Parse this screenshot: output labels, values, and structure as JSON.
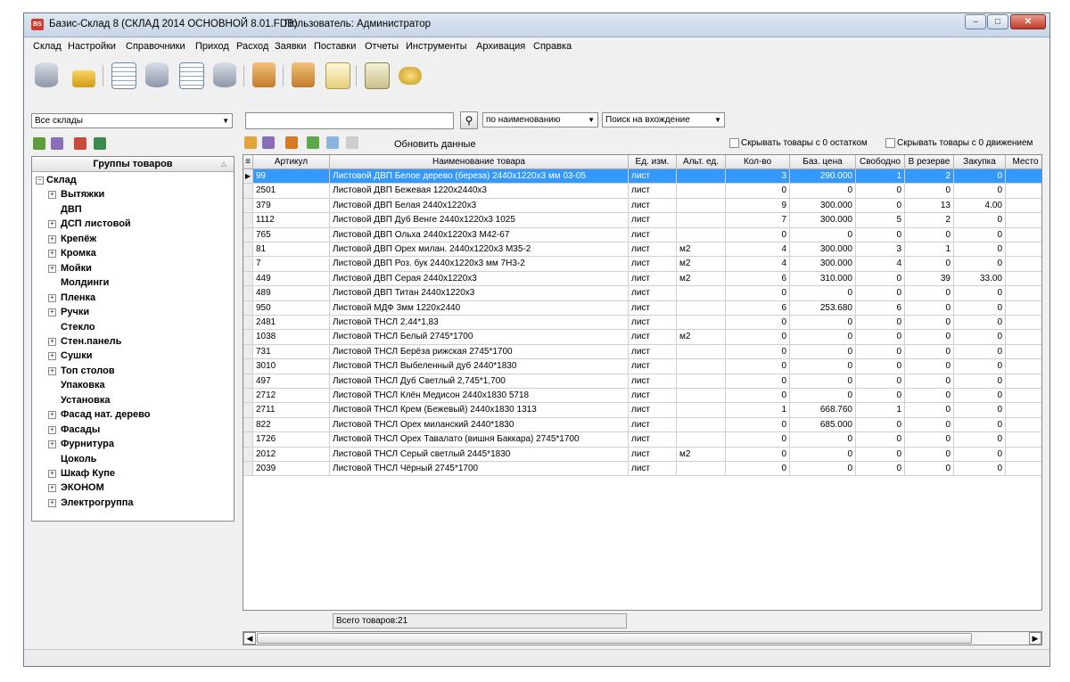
{
  "window": {
    "title": "Базис-Склад 8 (СКЛАД 2014 ОСНОВНОЙ 8.01.FDB)",
    "user": "Пользователь: Администратор",
    "app_icon_text": "BS",
    "buttons": [
      "–",
      "□",
      "✕"
    ]
  },
  "menu": [
    "Склад",
    "Настройки",
    "Справочники",
    "Приход",
    "Расход",
    "Заявки",
    "Поставки",
    "Отчеты",
    "Инструменты",
    "Архивация",
    "Справка"
  ],
  "toolbar_icons": [
    "database-icon",
    "lock-icon",
    "table-icon",
    "database-settings-icon",
    "table-settings-icon",
    "database-save-icon",
    "box-in-icon",
    "box-out-icon",
    "documents-icon",
    "export-icon",
    "coins-icon"
  ],
  "filters": {
    "warehouse": "Все склады",
    "search_value": "",
    "search_mode": "по наименованию",
    "search_type": "Поиск на вхождение"
  },
  "grid_toolbar": {
    "refresh_label": "Обновить данные",
    "hide_zero_stock": "Скрывать товары с 0 остатком",
    "hide_zero_movement": "Скрывать товары с 0 движением"
  },
  "groups": {
    "header": "Группы товаров",
    "root": "Склад",
    "items": [
      {
        "label": "Вытяжки",
        "expandable": true
      },
      {
        "label": "ДВП",
        "expandable": false
      },
      {
        "label": "ДСП листовой",
        "expandable": true
      },
      {
        "label": "Крепёж",
        "expandable": true
      },
      {
        "label": "Кромка",
        "expandable": true
      },
      {
        "label": "Мойки",
        "expandable": true
      },
      {
        "label": "Молдинги",
        "expandable": false
      },
      {
        "label": "Пленка",
        "expandable": true
      },
      {
        "label": "Ручки",
        "expandable": true
      },
      {
        "label": "Стекло",
        "expandable": false
      },
      {
        "label": "Стен.панель",
        "expandable": true
      },
      {
        "label": "Сушки",
        "expandable": true
      },
      {
        "label": "Топ столов",
        "expandable": true
      },
      {
        "label": "Упаковка",
        "expandable": false
      },
      {
        "label": "Установка",
        "expandable": false
      },
      {
        "label": "Фасад нат. дерево",
        "expandable": true
      },
      {
        "label": "Фасады",
        "expandable": true
      },
      {
        "label": "Фурнитура",
        "expandable": true
      },
      {
        "label": "Цоколь",
        "expandable": false
      },
      {
        "label": "Шкаф Купе",
        "expandable": true
      },
      {
        "label": "ЭКОНОМ",
        "expandable": true
      },
      {
        "label": "Электрогруппа",
        "expandable": true
      }
    ]
  },
  "table": {
    "columns": [
      "Артикул",
      "Наименование товара",
      "Ед. изм.",
      "Альт. ед.",
      "Кол-во",
      "Баз. цена",
      "Свободно",
      "В резерве",
      "Закупка",
      "Место"
    ],
    "rows": [
      [
        "99",
        "Листовой ДВП Белое дерево (береза)  2440х1220х3 мм  03-05",
        "лист",
        "",
        "3",
        "290.000",
        "1",
        "2",
        "0"
      ],
      [
        "2501",
        "Листовой ДВП Бежевая  1220х2440х3",
        "лист",
        "",
        "0",
        "0",
        "0",
        "0",
        "0"
      ],
      [
        "379",
        "Листовой ДВП Белая 2440х1220х3",
        "лист",
        "",
        "9",
        "300.000",
        "0",
        "13",
        "4.00"
      ],
      [
        "1112",
        "Листовой ДВП Дуб Венге  2440х1220х3  1025",
        "лист",
        "",
        "7",
        "300.000",
        "5",
        "2",
        "0"
      ],
      [
        "765",
        "Листовой ДВП Ольха  2440х1220х3  М42-67",
        "лист",
        "",
        "0",
        "0",
        "0",
        "0",
        "0"
      ],
      [
        "81",
        "Листовой ДВП Орех милан.  2440х1220х3  М35-2",
        "лист",
        "м2",
        "4",
        "300.000",
        "3",
        "1",
        "0"
      ],
      [
        "7",
        "Листовой ДВП Роз. бук  2440х1220х3 мм  7Н3-2",
        "лист",
        "м2",
        "4",
        "300.000",
        "4",
        "0",
        "0"
      ],
      [
        "449",
        "Листовой ДВП Серая  2440х1220х3",
        "лист",
        "м2",
        "6",
        "310.000",
        "0",
        "39",
        "33.00"
      ],
      [
        "489",
        "Листовой ДВП Титан 2440х1220х3",
        "лист",
        "",
        "0",
        "0",
        "0",
        "0",
        "0"
      ],
      [
        "950",
        "Листовой МДФ 3мм 1220х2440",
        "лист",
        "",
        "6",
        "253.680",
        "6",
        "0",
        "0"
      ],
      [
        "2481",
        "Листовой ТНСЛ  2,44*1,83",
        "лист",
        "",
        "0",
        "0",
        "0",
        "0",
        "0"
      ],
      [
        "1038",
        "Листовой ТНСЛ Белый  2745*1700",
        "лист",
        "м2",
        "0",
        "0",
        "0",
        "0",
        "0"
      ],
      [
        "731",
        "Листовой ТНСЛ Берёза рижская  2745*1700",
        "лист",
        "",
        "0",
        "0",
        "0",
        "0",
        "0"
      ],
      [
        "3010",
        "Листовой ТНСЛ Выбеленный дуб  2440*1830",
        "лист",
        "",
        "0",
        "0",
        "0",
        "0",
        "0"
      ],
      [
        "497",
        "Листовой ТНСЛ Дуб Светлый  2,745*1,700",
        "лист",
        "",
        "0",
        "0",
        "0",
        "0",
        "0"
      ],
      [
        "2712",
        "Листовой ТНСЛ Клён Медисон  2440х1830  5718",
        "лист",
        "",
        "0",
        "0",
        "0",
        "0",
        "0"
      ],
      [
        "2711",
        "Листовой ТНСЛ Крем (Бежевый)  2440х1830  1313",
        "лист",
        "",
        "1",
        "668.760",
        "1",
        "0",
        "0"
      ],
      [
        "822",
        "Листовой ТНСЛ Орех  миланский  2440*1830",
        "лист",
        "",
        "0",
        "685.000",
        "0",
        "0",
        "0"
      ],
      [
        "1726",
        "Листовой ТНСЛ Орех Тавалато (вишня Баккара) 2745*1700",
        "лист",
        "",
        "0",
        "0",
        "0",
        "0",
        "0"
      ],
      [
        "2012",
        "Листовой ТНСЛ Серый светлый  2445*1830",
        "лист",
        "м2",
        "0",
        "0",
        "0",
        "0",
        "0"
      ],
      [
        "2039",
        "Листовой ТНСЛ Чёрный  2745*1700",
        "лист",
        "",
        "0",
        "0",
        "0",
        "0",
        "0"
      ]
    ]
  },
  "footer": {
    "total": "Всего товаров:21"
  },
  "colors": {
    "selection": "#3399ff",
    "titlebar": "#c6d5e8",
    "close_button": "#c0392b"
  }
}
